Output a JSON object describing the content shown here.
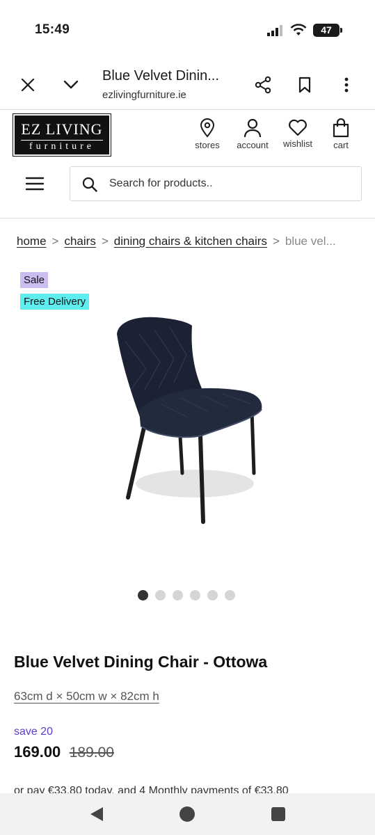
{
  "status_bar": {
    "time": "15:49",
    "battery": "47"
  },
  "browser": {
    "title": "Blue Velvet Dinin...",
    "domain": "ezlivingfurniture.ie",
    "icons": [
      "close-icon",
      "chevron-down-icon",
      "share-icon",
      "bookmark-icon",
      "more-vertical-icon"
    ]
  },
  "site_header": {
    "logo_top": "EZ LIVING",
    "logo_bottom": "furniture",
    "nav": {
      "stores": "stores",
      "account": "account",
      "wishlist": "wishlist",
      "cart": "cart"
    },
    "search": {
      "placeholder": "Search for products.."
    }
  },
  "breadcrumb": {
    "items": [
      "home",
      "chairs",
      "dining chairs & kitchen chairs"
    ],
    "separator": ">",
    "current": "blue vel..."
  },
  "badges": {
    "sale": "Sale",
    "delivery": "Free Delivery"
  },
  "colors": {
    "sale_badge": "#cbbcf2",
    "delivery_badge": "#5eeef0",
    "save_text": "#5b3cc4",
    "chair_velvet": "#1c2233"
  },
  "carousel": {
    "total": 6,
    "active_index": 0
  },
  "product": {
    "name": "Blue Velvet Dining Chair - Ottowa",
    "dimensions": "63cm d × 50cm w × 82cm h",
    "save": "save 20",
    "price": "169.00",
    "was_price": "189.00",
    "installments": "or pay €33.80 today, and 4 Monthly payments of €33.80"
  }
}
